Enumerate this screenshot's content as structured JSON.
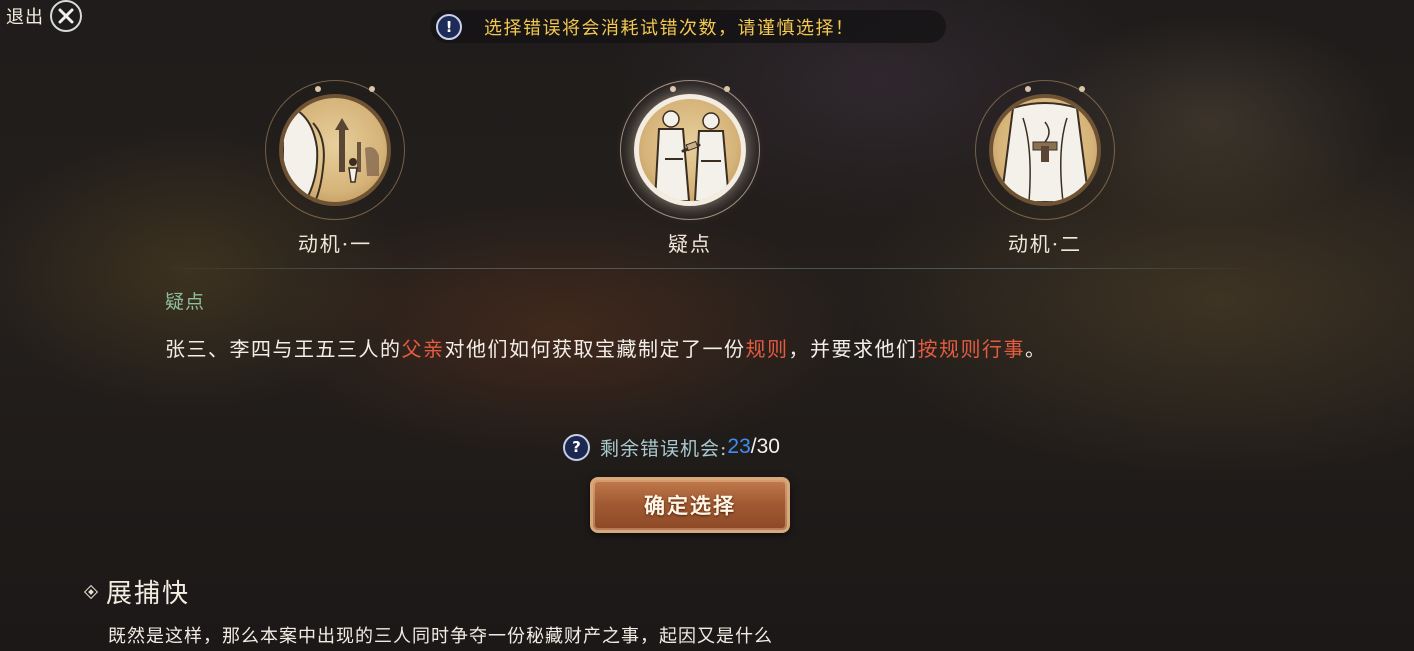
{
  "header": {
    "exit_label": "退出",
    "warning_text": "选择错误将会消耗试错次数，请谨慎选择！"
  },
  "choices": [
    {
      "label": "动机·一",
      "icon": "scroll-figure-portrait",
      "selected": false
    },
    {
      "label": "疑点",
      "icon": "two-figures-exchange-portrait",
      "selected": true
    },
    {
      "label": "动机·二",
      "icon": "robed-figure-portrait",
      "selected": false
    }
  ],
  "clue": {
    "title": "疑点",
    "text_parts": [
      {
        "text": "张三、李四与王五三人的",
        "highlight": false
      },
      {
        "text": "父亲",
        "highlight": true
      },
      {
        "text": "对他们如何获取宝藏制定了一份",
        "highlight": false
      },
      {
        "text": "规则",
        "highlight": true
      },
      {
        "text": "，并要求他们",
        "highlight": false
      },
      {
        "text": "按规则行事",
        "highlight": true
      },
      {
        "text": "。",
        "highlight": false
      }
    ]
  },
  "chances": {
    "label": "剩余错误机会:",
    "current": "23",
    "separator": "/",
    "max": "30"
  },
  "confirm_button": {
    "label": "确定选择"
  },
  "dialogue": {
    "speaker": "展捕快",
    "text": "既然是这样，那么本案中出现的三人同时争夺一份秘藏财产之事，起因又是什么"
  },
  "colors": {
    "warning_text": "#f2c84f",
    "highlight": "#e35b40",
    "clue_title": "#8fbe9e",
    "chances_current": "#3f8cf5",
    "button": "#a25b33"
  }
}
